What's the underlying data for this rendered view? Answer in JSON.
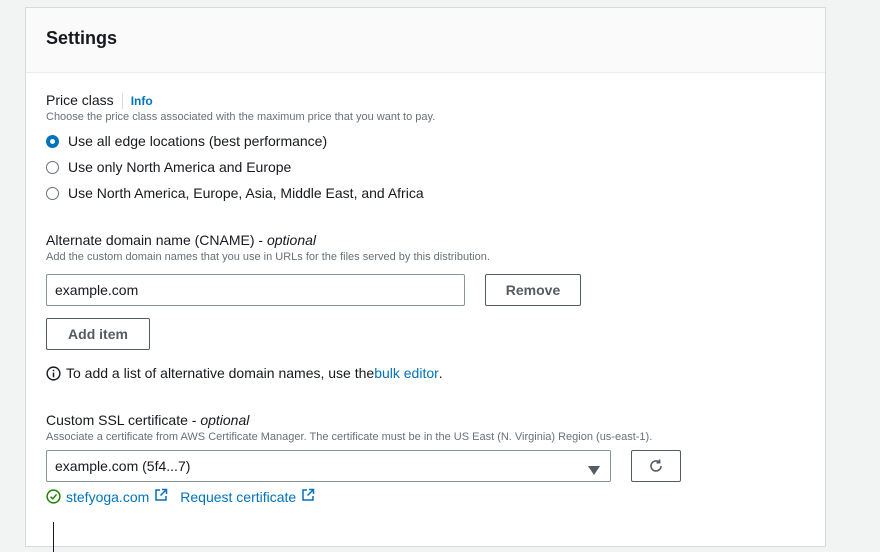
{
  "settings": {
    "title": "Settings",
    "price_class": {
      "label": "Price class",
      "info": "Info",
      "description": "Choose the price class associated with the maximum price that you want to pay.",
      "options": [
        {
          "label": "Use all edge locations (best performance)",
          "selected": true
        },
        {
          "label": "Use only North America and Europe",
          "selected": false
        },
        {
          "label": "Use North America, Europe, Asia, Middle East, and Africa",
          "selected": false
        }
      ]
    },
    "cname": {
      "label": "Alternate domain name (CNAME) - ",
      "optional": "optional",
      "description": "Add the custom domain names that you use in URLs for the files served by this distribution.",
      "value": "example.com",
      "remove_label": "Remove",
      "add_item_label": "Add item",
      "note_prefix": "To add a list of alternative domain names, use the ",
      "note_link": "bulk editor",
      "note_suffix": "."
    },
    "ssl": {
      "label": "Custom SSL certificate - ",
      "optional": "optional",
      "description": "Associate a certificate from AWS Certificate Manager. The certificate must be in the US East (N. Virginia) Region (us-east-1).",
      "selected": "example.com (5f4...7)",
      "status_link": "stefyoga.com",
      "request_link": "Request certificate"
    }
  },
  "colors": {
    "accent": "#0073bb",
    "success": "#1d8102",
    "text": "#16191f",
    "muted": "#687078"
  }
}
